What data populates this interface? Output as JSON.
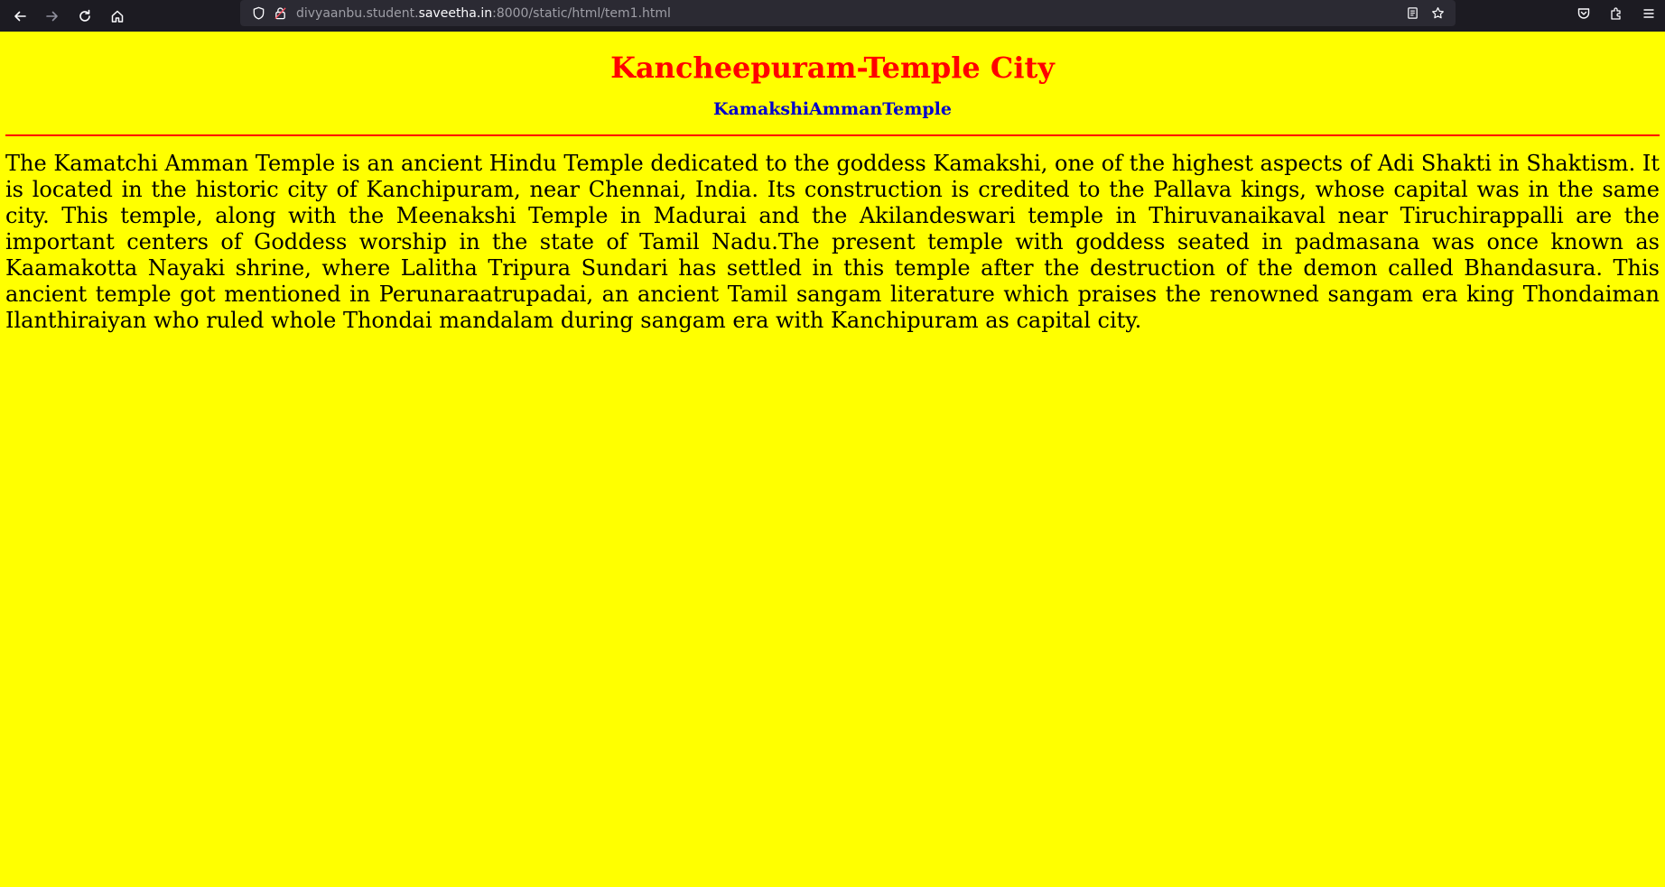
{
  "browser": {
    "url_prefix": "divyaanbu.student.",
    "url_domain": "saveetha.in",
    "url_suffix": ":8000/static/html/tem1.html",
    "icons": {
      "back": "arrow-left-icon",
      "forward": "arrow-right-icon",
      "reload": "reload-icon",
      "home": "home-icon",
      "tracking": "shield-icon",
      "connection": "lock-icon",
      "reader": "reader-view-icon",
      "bookmark": "star-icon",
      "pocket": "pocket-icon",
      "extensions": "puzzle-icon",
      "menu": "hamburger-menu-icon"
    }
  },
  "page": {
    "background": "#ffff00",
    "title": "Kancheepuram-Temple City",
    "title_color": "#ff0000",
    "subtitle": "KamakshiAmmanTemple",
    "subtitle_color": "#0000cc",
    "divider_color": "#ff0000",
    "paragraph": "The Kamatchi Amman Temple is an ancient Hindu Temple dedicated to the goddess Kamakshi, one of the highest aspects of Adi Shakti in Shaktism. It is located in the historic city of Kanchipuram, near Chennai, India. Its construction is credited to the Pallava kings, whose capital was in the same city. This temple, along with the Meenakshi Temple in Madurai and the Akilandeswari temple in Thiruvanaikaval near Tiruchirappalli are the important centers of Goddess worship in the state of Tamil Nadu.The present temple with goddess seated in padmasana was once known as Kaamakotta Nayaki shrine, where Lalitha Tripura Sundari has settled in this temple after the destruction of the demon called Bhandasura. This ancient temple got mentioned in Perunaraatrupadai, an ancient Tamil sangam literature which praises the renowned sangam era king Thondaiman Ilanthiraiyan who ruled whole Thondai mandalam during sangam era with Kanchipuram as capital city."
  }
}
